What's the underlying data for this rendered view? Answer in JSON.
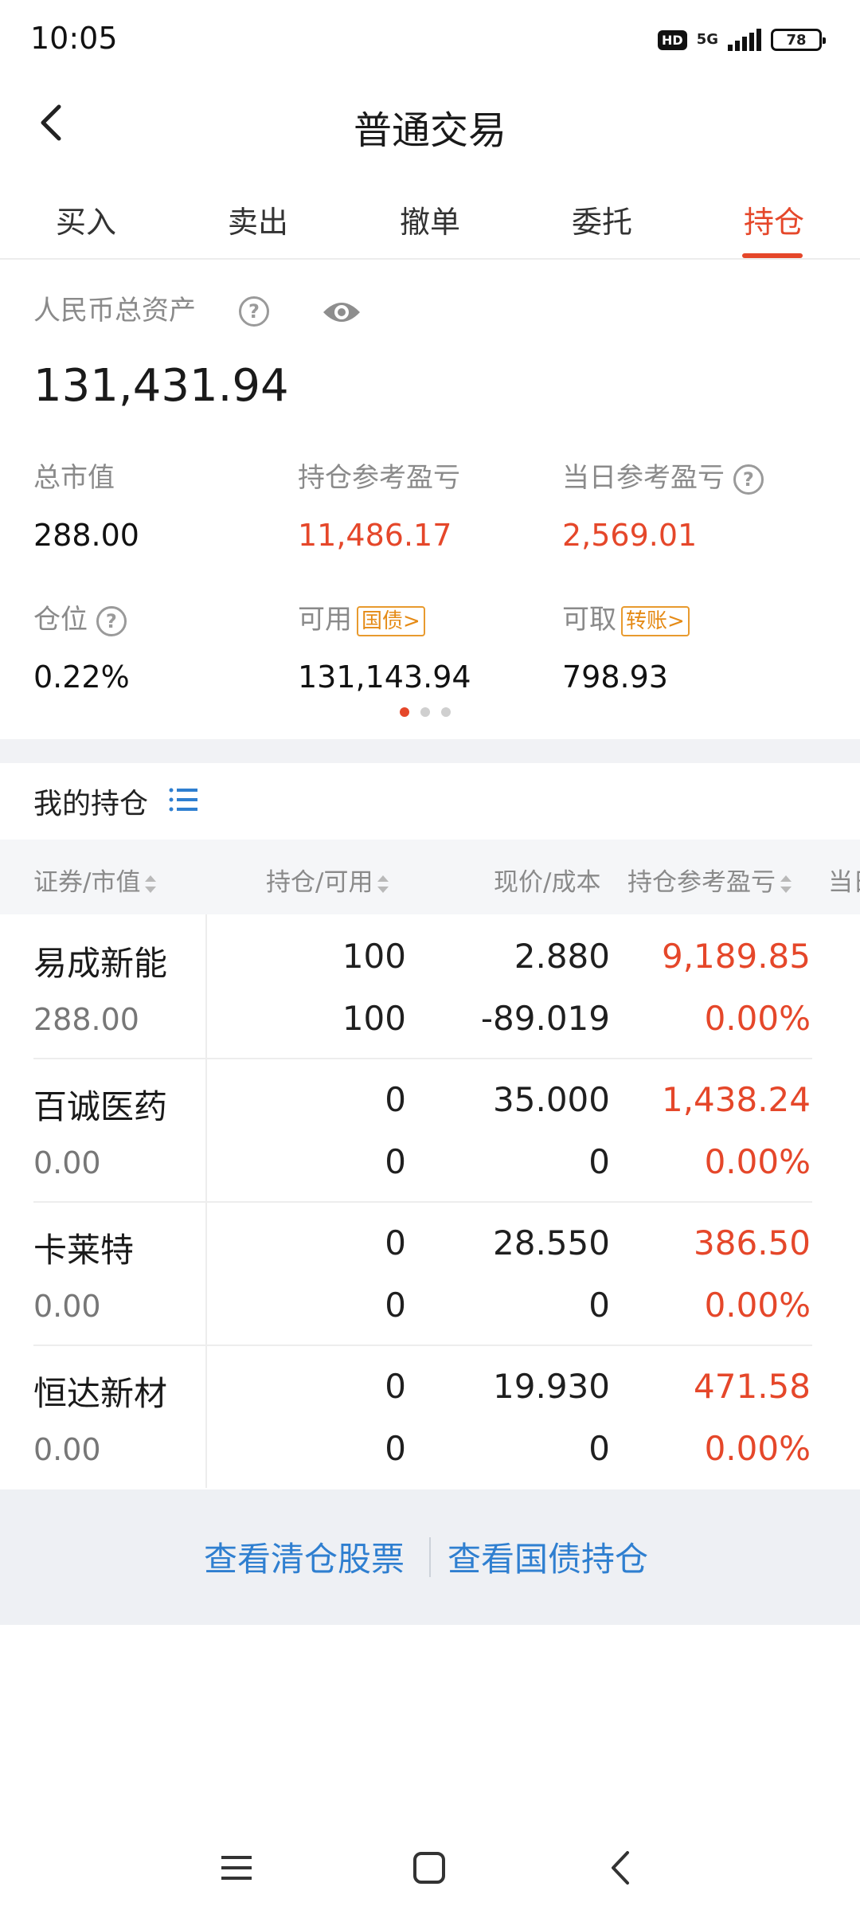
{
  "status": {
    "time": "10:05",
    "hd": "HD",
    "network": "5G",
    "battery": "78"
  },
  "header": {
    "title": "普通交易"
  },
  "tabs": [
    {
      "label": "买入"
    },
    {
      "label": "卖出"
    },
    {
      "label": "撤单"
    },
    {
      "label": "委托"
    },
    {
      "label": "持仓"
    }
  ],
  "active_tab": "持仓",
  "assets": {
    "total_label": "人民币总资产",
    "total_value": "131,431.94",
    "stats": [
      {
        "label": "总市值",
        "value": "288.00"
      },
      {
        "label": "持仓参考盈亏",
        "value": "11,486.17"
      },
      {
        "label": "当日参考盈亏",
        "value": "2,569.01"
      },
      {
        "label": "仓位",
        "value": "0.22%"
      },
      {
        "label": "可用",
        "tag": "国债>",
        "value": "131,143.94"
      },
      {
        "label": "可取",
        "tag": "转账>",
        "value": "798.93"
      }
    ]
  },
  "holdings": {
    "title": "我的持仓",
    "columns": [
      "证券/市值",
      "持仓/可用",
      "现价/成本",
      "持仓参考盈亏",
      "当日"
    ],
    "rows": [
      {
        "name": "易成新能",
        "market_value": "288.00",
        "hold": "100",
        "avail": "100",
        "price": "2.880",
        "cost": "-89.019",
        "pl": "9,189.85",
        "pl_pct": "0.00%"
      },
      {
        "name": "百诚医药",
        "market_value": "0.00",
        "hold": "0",
        "avail": "0",
        "price": "35.000",
        "cost": "0",
        "pl": "1,438.24",
        "pl_pct": "0.00%"
      },
      {
        "name": "卡莱特",
        "market_value": "0.00",
        "hold": "0",
        "avail": "0",
        "price": "28.550",
        "cost": "0",
        "pl": "386.50",
        "pl_pct": "0.00%"
      },
      {
        "name": "恒达新材",
        "market_value": "0.00",
        "hold": "0",
        "avail": "0",
        "price": "19.930",
        "cost": "0",
        "pl": "471.58",
        "pl_pct": "0.00%"
      }
    ]
  },
  "footer": {
    "link1": "查看清仓股票",
    "link2": "查看国债持仓"
  },
  "colors": {
    "accent": "#e5472a",
    "link": "#2f7fd0",
    "tag": "#e58a15"
  },
  "icons": {
    "back": "chevron-left-icon",
    "help": "question-circle-icon",
    "visibility": "eye-icon",
    "list": "list-icon"
  }
}
